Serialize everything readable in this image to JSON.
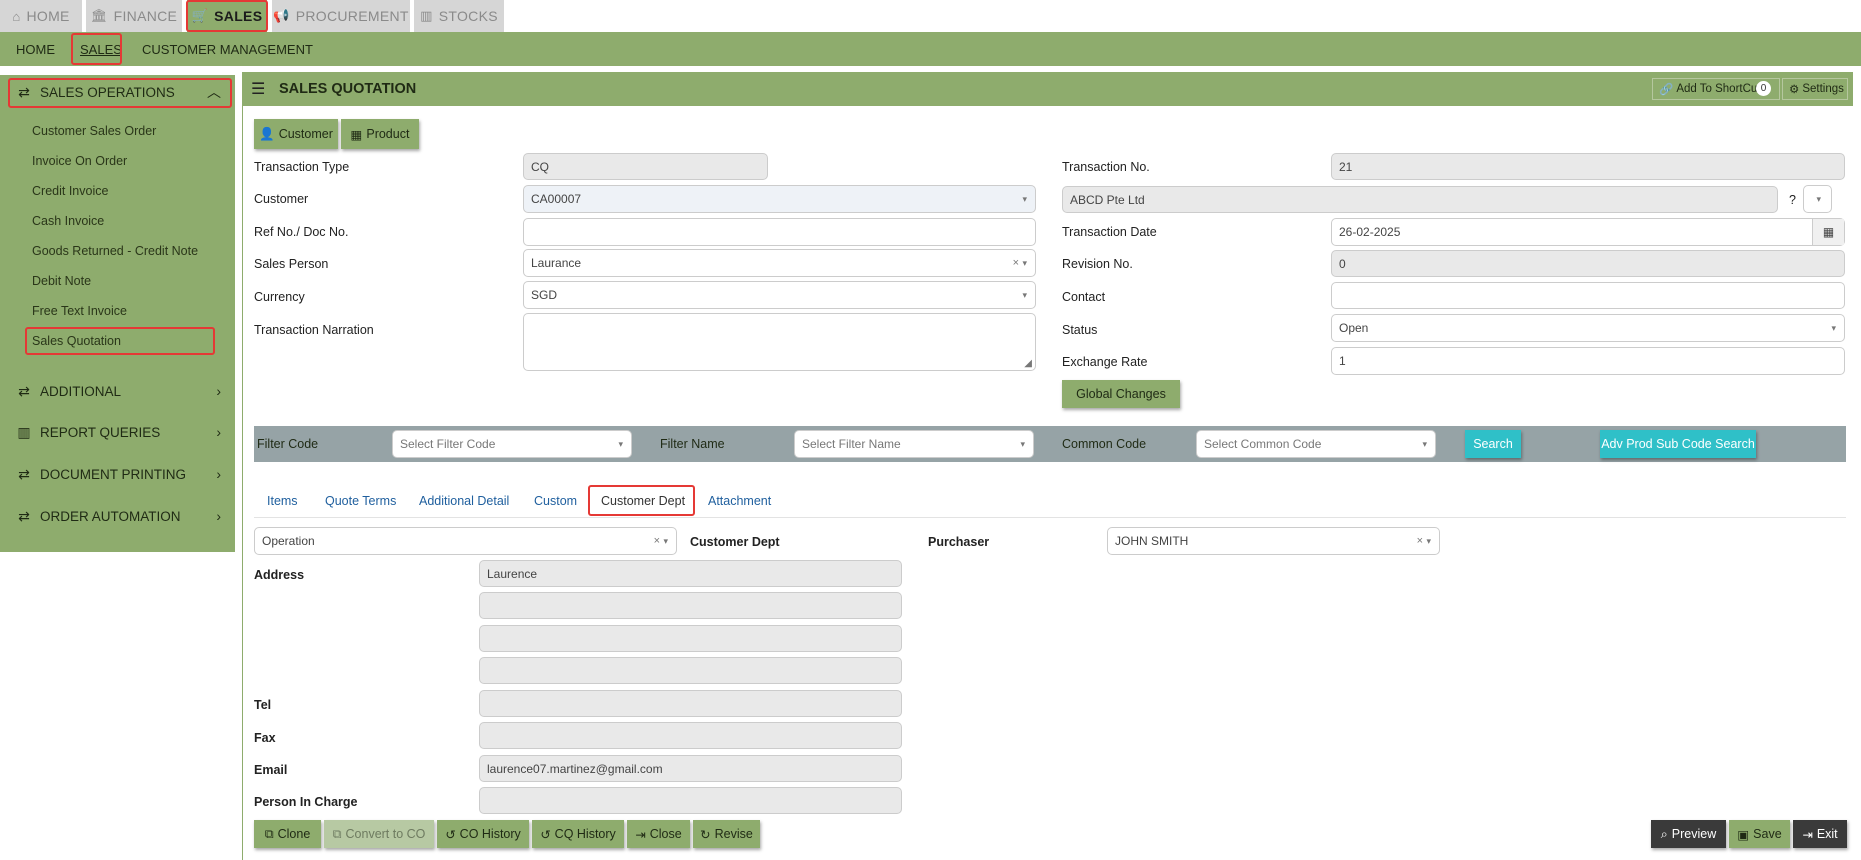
{
  "top_tabs": [
    {
      "label": "HOME",
      "icon": "home-icon",
      "glyph": "⌂"
    },
    {
      "label": "FINANCE",
      "icon": "bank-icon",
      "glyph": "🏛"
    },
    {
      "label": "SALES",
      "icon": "cart-icon",
      "glyph": "🛒"
    },
    {
      "label": "PROCUREMENT",
      "icon": "bullhorn-icon",
      "glyph": "📢"
    },
    {
      "label": "STOCKS",
      "icon": "bar-chart-icon",
      "glyph": "▥"
    }
  ],
  "subnav": [
    "HOME",
    "SALES",
    "CUSTOMER MANAGEMENT"
  ],
  "sidebar": {
    "sales_operations": "SALES OPERATIONS",
    "items": [
      "Customer Sales Order",
      "Invoice On Order",
      "Credit Invoice",
      "Cash Invoice",
      "Goods Returned - Credit Note",
      "Debit Note",
      "Free Text Invoice",
      "Sales Quotation"
    ],
    "sections": [
      "ADDITIONAL",
      "REPORT QUERIES",
      "DOCUMENT PRINTING",
      "ORDER AUTOMATION"
    ]
  },
  "header": {
    "title": "SALES QUOTATION",
    "shortcut_label": "Add To ShortCut",
    "shortcut_count": "0",
    "settings_label": "Settings"
  },
  "lookup_buttons": {
    "customer": "Customer",
    "product": "Product"
  },
  "form": {
    "transaction_type_label": "Transaction Type",
    "transaction_type": "CQ",
    "customer_label": "Customer",
    "customer_code": "CA00007",
    "ref_label": "Ref No./ Doc No.",
    "ref_value": "",
    "sales_person_label": "Sales Person",
    "sales_person": "Laurance",
    "currency_label": "Currency",
    "currency": "SGD",
    "narration_label": "Transaction Narration",
    "narration": "",
    "transaction_no_label": "Transaction No.",
    "transaction_no": "21",
    "customer_name": "ABCD Pte Ltd",
    "help_mark": "?",
    "transaction_date_label": "Transaction Date",
    "transaction_date": "26-02-2025",
    "revision_label": "Revision No.",
    "revision": "0",
    "contact_label": "Contact",
    "contact": "",
    "status_label": "Status",
    "status": "Open",
    "exchange_rate_label": "Exchange Rate",
    "exchange_rate": "1",
    "global_changes": "Global Changes"
  },
  "filter": {
    "code_label": "Filter Code",
    "code_placeholder": "Select Filter Code",
    "name_label": "Filter Name",
    "name_placeholder": "Select Filter Name",
    "common_label": "Common Code",
    "common_placeholder": "Select Common Code",
    "search": "Search",
    "adv_search": "Adv Prod Sub Code Search"
  },
  "detail_tabs": [
    "Items",
    "Quote Terms",
    "Additional Detail",
    "Custom",
    "Customer Dept",
    "Attachment"
  ],
  "dept": {
    "operation": "Operation",
    "customer_dept_label": "Customer Dept",
    "purchaser_label": "Purchaser",
    "purchaser": "JOHN SMITH",
    "address_label": "Address",
    "address1": "Laurence",
    "address2": "",
    "address3": "",
    "address4": "",
    "tel_label": "Tel",
    "tel": "",
    "fax_label": "Fax",
    "fax": "",
    "email_label": "Email",
    "email": "laurence07.martinez@gmail.com",
    "pic_label": "Person In Charge",
    "pic": ""
  },
  "footer_buttons": {
    "clone": "Clone",
    "convert": "Convert to CO",
    "co_history": "CO History",
    "cq_history": "CQ History",
    "close": "Close",
    "revise": "Revise",
    "preview": "Preview",
    "save": "Save",
    "exit": "Exit"
  },
  "colors": {
    "theme_green": "#8eac6d",
    "filter_gray": "#96a3a6",
    "teal": "#2fc0c8",
    "highlight_red": "#e53935"
  }
}
